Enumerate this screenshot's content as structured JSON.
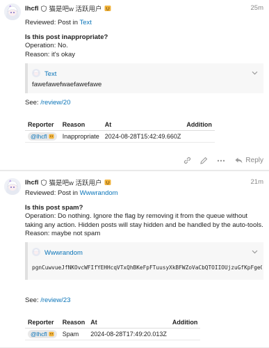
{
  "posts": [
    {
      "username": "lhcfl",
      "nickname": "猫是吧w 活跃用户",
      "time": "25m",
      "reviewed_prefix": "Reviewed: Post in ",
      "reviewed_link": "Text",
      "question": "Is this post inappropriate?",
      "operation": "Operation: No.",
      "reason": "Reason: it's okay",
      "quote": {
        "topic": "Text",
        "text": "fawefawefwaefawefawe"
      },
      "see_prefix": "See: ",
      "see_link": "/review/20",
      "table": {
        "headers": [
          "Reporter",
          "Reason",
          "At",
          "Addition"
        ],
        "row": {
          "reporter": "@lhcfl",
          "reason": "Inappropriate",
          "at": "2024-08-28T15:42:49.660Z",
          "addition": ""
        }
      },
      "reply_label": "Reply"
    },
    {
      "username": "lhcfl",
      "nickname": "猫是吧w 活跃用户",
      "time": "21m",
      "reviewed_prefix": "Reviewed: Post in ",
      "reviewed_link": "Wwwrandom",
      "question": "Is this post spam?",
      "operation": "Operation: Do nothing. Ignore the flag by removing it from the queue without taking any action. Hidden posts will stay hidden and be handled by the auto-tools.",
      "reason": "Reason: maybe not spam",
      "quote": {
        "topic": "Wwwrandom",
        "text": "pgnCuwvueJfNKOvcWFIfYEHHcqVTxQhBKeFpFTuusyXkBFWZoVaCbQTOIIOUjzuGfKpFgeQTza"
      },
      "see_prefix": "See: ",
      "see_link": "/review/23",
      "table": {
        "headers": [
          "Reporter",
          "Reason",
          "At",
          "Addition"
        ],
        "row": {
          "reporter": "@lhcfl",
          "reason": "Spam",
          "at": "2024-08-28T17:49:20.013Z",
          "addition": ""
        }
      }
    }
  ],
  "icons": {
    "shield": "shield-icon",
    "badge": "emoji-badge-icon",
    "chevron": "chevron-down-icon",
    "link": "link-icon",
    "edit": "pencil-icon",
    "more": "ellipsis-icon",
    "reply": "reply-icon"
  },
  "colors": {
    "link": "#0a74b8",
    "meta": "#888888",
    "quote_bg": "#f7f7f7"
  }
}
